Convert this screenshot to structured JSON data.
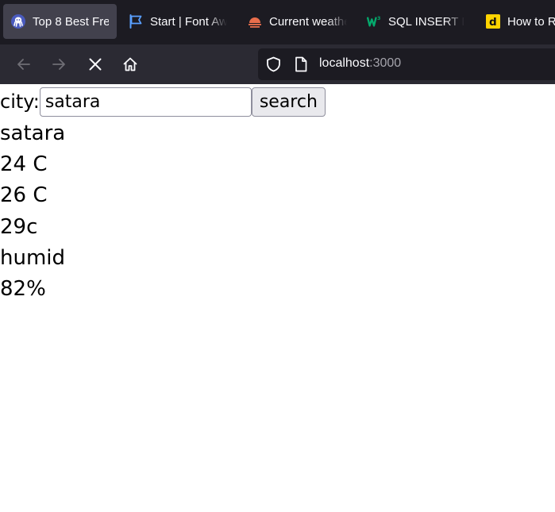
{
  "browser": {
    "tabs": [
      {
        "title": "Top 8 Best Fre",
        "icon": "octopus-icon",
        "active": true
      },
      {
        "title": "Start | Font Aw",
        "icon": "flag-icon",
        "active": false
      },
      {
        "title": "Current weathe",
        "icon": "weather-icon",
        "active": false
      },
      {
        "title": "SQL INSERT IN",
        "icon": "w3schools-icon",
        "active": false
      },
      {
        "title": "How to R",
        "icon": "dev-icon",
        "active": false
      }
    ],
    "url": {
      "host": "localhost",
      "port": ":3000"
    }
  },
  "form": {
    "city_label": "city:",
    "city_value": "satara",
    "search_label": "search"
  },
  "results": [
    "satara",
    "24 C",
    "26 C",
    "29c",
    "humid",
    "82%"
  ]
}
